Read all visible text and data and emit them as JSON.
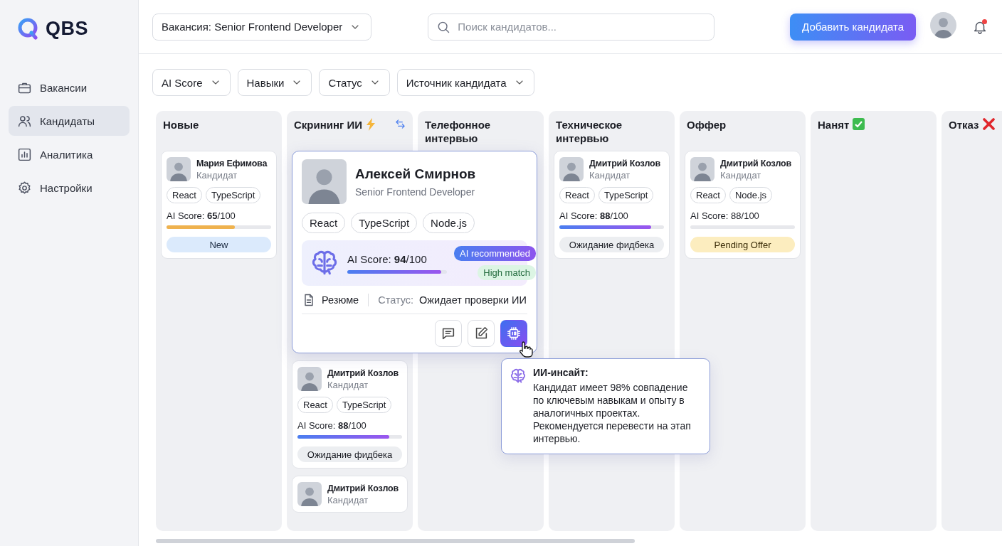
{
  "sidebar": {
    "logo": "QBS",
    "items": [
      {
        "label": "Вакансии",
        "selected": false
      },
      {
        "label": "Кандидаты",
        "selected": true
      },
      {
        "label": "Аналитика",
        "selected": false
      },
      {
        "label": "Настройки",
        "selected": false
      }
    ]
  },
  "topbar": {
    "vacancy_select": "Вакансия: Senior Frontend Developer",
    "search": {
      "placeholder": "Поиск кандидатов..."
    },
    "add_button": "Добавить кандидата",
    "has_notification": true
  },
  "filters": [
    "AI Score",
    "Навыки",
    "Статус",
    "Источник кандидата"
  ],
  "columns": [
    {
      "title": "Новые",
      "cards": [
        {
          "kind": "compact",
          "name": "Мария Ефимова",
          "role": "Кандидат",
          "tags": [
            "React",
            "TypeScript"
          ],
          "score": "AI Score: **65**/100",
          "level": 0.65,
          "status": {
            "label": "New",
            "kind": "new"
          }
        }
      ]
    },
    {
      "title": "Скрининг ИИ",
      "cards": [
        {
          "kind": "expanded",
          "name": "Алексей Смирнов",
          "role": "Senior Frontend Developer",
          "tags": [
            "React",
            "TypeScript",
            "Node.js"
          ],
          "score": "AI Score: **94**/100",
          "level": 0.94,
          "badges": [
            "AI recommended",
            "High match"
          ],
          "resume": "Резюме",
          "status_label": "Статус:",
          "status_value": "Ожидает проверки ИИ",
          "actions": [
            {
              "active": false
            },
            {
              "active": false
            },
            {
              "active": true
            }
          ]
        },
        {
          "kind": "compact",
          "name": "Дмитрий Козлов",
          "role": "Кандидат",
          "tags": [
            "React",
            "TypeScript"
          ],
          "score": "AI Score: **88**/100",
          "level": 0.88,
          "status": {
            "label": "Ожидание фидбека",
            "kind": "waiting"
          }
        },
        {
          "kind": "compact",
          "name": "Дмитрий Козлов",
          "role": "Кандидат"
        }
      ]
    },
    {
      "title": "Телефонное интервью"
    },
    {
      "title": "Техническое интервью",
      "cards": [
        {
          "kind": "compact",
          "name": "Дмитрий Козлов",
          "role": "Кандидат",
          "tags": [
            "React",
            "TypeScript"
          ],
          "score": "AI Score: **88**/100",
          "level": 0.88,
          "status": {
            "label": "Ожидание фидбека",
            "kind": "waiting"
          }
        }
      ]
    },
    {
      "title": "Оффер",
      "cards": [
        {
          "kind": "compact",
          "name": "Дмитрий Козлов",
          "role": "Кандидат",
          "tags": [
            "React",
            "Node.js"
          ],
          "score": "AI Score: 88/100",
          "status": {
            "label": "Pending Offer",
            "kind": "pending"
          }
        }
      ]
    },
    {
      "title": "Нанят"
    },
    {
      "title": "Отказ"
    }
  ],
  "insight": {
    "title": "ИИ-инсайт:",
    "text": "Кандидат имеет 98% совпадение по ключевым навыкам и опыту в аналогичных проектах. Рекомендуется перевести на этап интервью."
  }
}
